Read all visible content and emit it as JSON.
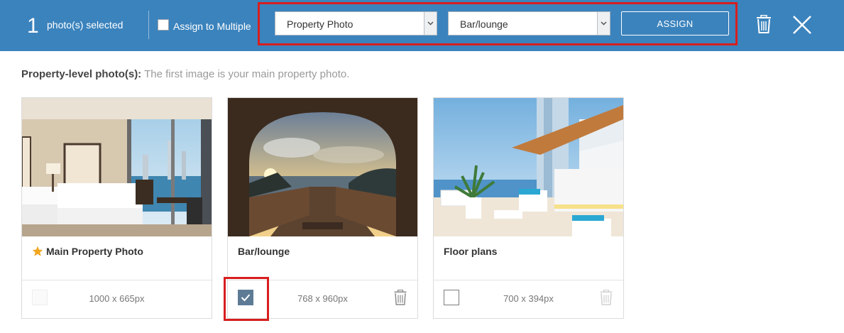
{
  "topbar": {
    "selected_count": "1",
    "selected_label": "photo(s) selected",
    "assign_multiple_label": "Assign to Multiple",
    "assign_multiple_checked": false,
    "category_select_value": "Property Photo",
    "subcategory_select_value": "Bar/lounge",
    "assign_button_label": "ASSIGN",
    "delete_icon": "trash-icon",
    "close_icon": "close-icon"
  },
  "intro": {
    "heading": "Property-level photo(s):",
    "text": "The first image is your main property photo."
  },
  "cards": [
    {
      "title": "Main Property Photo",
      "dimensions": "1000 x 665px",
      "is_main": true,
      "checked": false,
      "checkbox_disabled": true,
      "trash": false
    },
    {
      "title": "Bar/lounge",
      "dimensions": "768 x 960px",
      "is_main": false,
      "checked": true,
      "checkbox_disabled": false,
      "trash": true
    },
    {
      "title": "Floor plans",
      "dimensions": "700 x 394px",
      "is_main": false,
      "checked": false,
      "checkbox_disabled": false,
      "trash": true,
      "trash_faded": true
    }
  ],
  "colors": {
    "topbar_bg": "#3b83bd",
    "highlight_red": "#d81e1e",
    "checked_bg": "#5d7b95",
    "star": "#f2a51f"
  }
}
